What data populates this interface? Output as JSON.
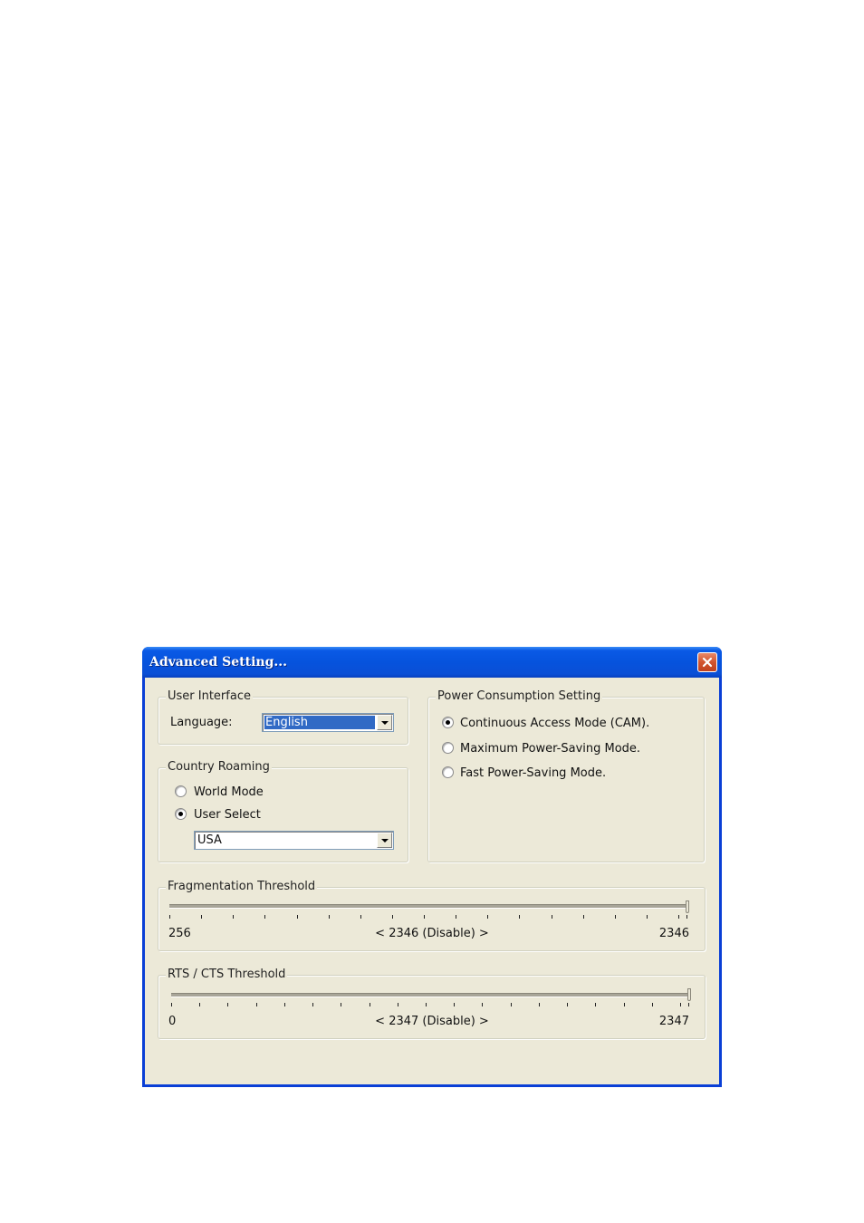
{
  "window": {
    "title": "Advanced Setting...",
    "close_icon": "close-x-icon",
    "colors": {
      "titlebar": "#0653dd",
      "close_button": "#d2542e",
      "client": "#ece9d8",
      "selection": "#316ac5"
    }
  },
  "user_interface": {
    "legend": "User Interface",
    "language_label": "Language:",
    "language_value": "English"
  },
  "country_roaming": {
    "legend": "Country Roaming",
    "options": [
      {
        "label": "World Mode",
        "checked": false
      },
      {
        "label": "User Select",
        "checked": true
      }
    ],
    "country_value": "USA"
  },
  "power_consumption": {
    "legend": "Power Consumption Setting",
    "options": [
      {
        "label": "Continuous Access Mode (CAM).",
        "checked": true
      },
      {
        "label": "Maximum Power-Saving Mode.",
        "checked": false
      },
      {
        "label": "Fast Power-Saving Mode.",
        "checked": false
      }
    ]
  },
  "fragmentation": {
    "legend": "Fragmentation Threshold",
    "min_label": "256",
    "max_label": "2346",
    "current_label": "< 2346 (Disable) >",
    "min": 256,
    "max": 2346,
    "value": 2346,
    "tick_count": 17
  },
  "rts_cts": {
    "legend": "RTS / CTS Threshold",
    "min_label": "0",
    "max_label": "2347",
    "current_label": "< 2347 (Disable) >",
    "min": 0,
    "max": 2347,
    "value": 2347,
    "tick_count": 19
  }
}
